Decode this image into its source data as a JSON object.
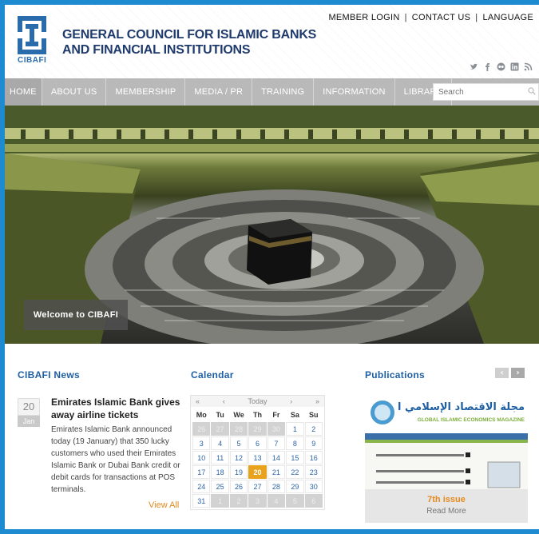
{
  "header": {
    "logo_text": "CIBAFI",
    "org_name": "GENERAL COUNCIL FOR ISLAMIC BANKS AND FINANCIAL INSTITUTIONS",
    "top_links": [
      "MEMBER LOGIN",
      "CONTACT US",
      "LANGUAGE"
    ],
    "social_icons": [
      "twitter-icon",
      "facebook-icon",
      "flickr-icon",
      "linkedin-icon",
      "rss-icon"
    ]
  },
  "nav": {
    "items": [
      "HOME",
      "ABOUT US",
      "MEMBERSHIP",
      "MEDIA / PR",
      "TRAINING",
      "INFORMATION",
      "LIBRARY"
    ],
    "search_placeholder": "Search"
  },
  "hero": {
    "caption": "Welcome to CIBAFI"
  },
  "news": {
    "title": "CIBAFI News",
    "date_day": "20",
    "date_month": "Jan",
    "headline": "Emirates Islamic Bank gives away airline tickets",
    "body": "Emirates Islamic Bank announced today (19 January) that 350 lucky customers who used their Emirates Islamic Bank or Dubai Bank credit or debit cards for transactions at POS terminals.",
    "view_all": "View All"
  },
  "calendar": {
    "title": "Calendar",
    "nav_prev_year": "«",
    "nav_prev": "‹",
    "label": "Today",
    "nav_next": "›",
    "nav_next_year": "»",
    "days": [
      "Mo",
      "Tu",
      "We",
      "Th",
      "Fr",
      "Sa",
      "Su"
    ],
    "today": "20",
    "weeks": [
      [
        {
          "d": "26",
          "o": true
        },
        {
          "d": "27",
          "o": true
        },
        {
          "d": "28",
          "o": true
        },
        {
          "d": "29",
          "o": true
        },
        {
          "d": "30",
          "o": true
        },
        {
          "d": "1"
        },
        {
          "d": "2"
        }
      ],
      [
        {
          "d": "3"
        },
        {
          "d": "4"
        },
        {
          "d": "5"
        },
        {
          "d": "6"
        },
        {
          "d": "7"
        },
        {
          "d": "8"
        },
        {
          "d": "9"
        }
      ],
      [
        {
          "d": "10"
        },
        {
          "d": "11"
        },
        {
          "d": "12"
        },
        {
          "d": "13"
        },
        {
          "d": "14"
        },
        {
          "d": "15"
        },
        {
          "d": "16"
        }
      ],
      [
        {
          "d": "17"
        },
        {
          "d": "18"
        },
        {
          "d": "19"
        },
        {
          "d": "20"
        },
        {
          "d": "21"
        },
        {
          "d": "22"
        },
        {
          "d": "23"
        }
      ],
      [
        {
          "d": "24"
        },
        {
          "d": "25"
        },
        {
          "d": "26"
        },
        {
          "d": "27"
        },
        {
          "d": "28"
        },
        {
          "d": "29"
        },
        {
          "d": "30"
        }
      ],
      [
        {
          "d": "31"
        },
        {
          "d": "1",
          "o": true
        },
        {
          "d": "2",
          "o": true
        },
        {
          "d": "3",
          "o": true
        },
        {
          "d": "4",
          "o": true
        },
        {
          "d": "5",
          "o": true
        },
        {
          "d": "6",
          "o": true
        }
      ]
    ]
  },
  "publications": {
    "title": "Publications",
    "prev": "‹",
    "next": "›",
    "cover_title_ar": "مجلة الاقتصاد الإسلامي العالمية",
    "cover_title_en": "GLOBAL ISLAMIC ECONOMICS MAGAZINE",
    "issue_title": "7th issue",
    "read_more": "Read More"
  },
  "colors": {
    "accent": "#e58a1f",
    "brand_blue": "#1f5fa3",
    "nav_gray": "#b9b9b9",
    "frame_blue": "#1e8bd0"
  }
}
